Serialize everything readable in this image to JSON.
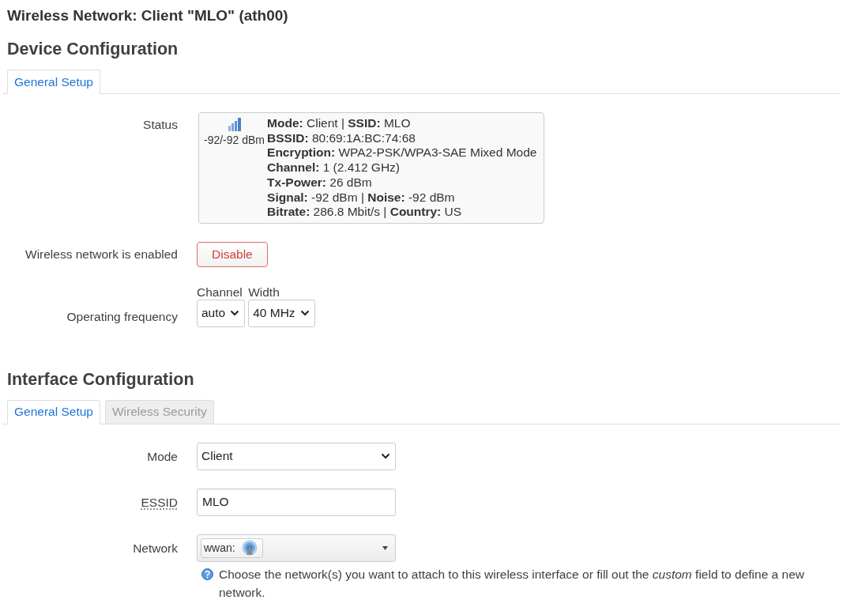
{
  "page_title": "Wireless Network: Client \"MLO\" (ath00)",
  "device_configuration": {
    "heading": "Device Configuration",
    "tabs": [
      {
        "label": "General Setup",
        "selected": true
      }
    ],
    "fields": [
      {
        "kind": "status",
        "label": "Status",
        "signal_reading": "-92/-92 dBm",
        "lines": [
          "**Mode:** Client | **SSID:** MLO",
          "**BSSID:** 80:69:1A:BC:74:68",
          "**Encryption:** WPA2-PSK/WPA3-SAE Mixed Mode",
          "**Channel:** 1 (2.412 GHz)",
          "**Tx-Power:** 26 dBm",
          "**Signal:** -92 dBm | **Noise:** -92 dBm",
          "**Bitrate:** 286.8 Mbit/s | **Country:** US"
        ]
      },
      {
        "kind": "button",
        "label": "Wireless network is enabled",
        "button": "Disable"
      },
      {
        "kind": "select_group",
        "label": "Operating frequency",
        "selects": [
          {
            "caption": "Channel",
            "value": "auto"
          },
          {
            "caption": "Width",
            "value": "40 MHz"
          }
        ]
      }
    ]
  },
  "interface_configuration": {
    "heading": "Interface Configuration",
    "tabs": [
      {
        "label": "General Setup",
        "selected": true
      },
      {
        "label": "Wireless Security",
        "selected": false
      }
    ],
    "fields": [
      {
        "kind": "select",
        "label": "Mode",
        "label_dotted": false,
        "value": "Client"
      },
      {
        "kind": "text",
        "label": "ESSID",
        "label_dotted": true,
        "value": "MLO"
      },
      {
        "kind": "network",
        "label": "Network",
        "label_dotted": false,
        "chips": [
          {
            "label": "wwan:"
          }
        ],
        "help": "Choose the network(s) you want to attach to this wireless interface or fill out the *custom* field to define a new network."
      }
    ]
  }
}
